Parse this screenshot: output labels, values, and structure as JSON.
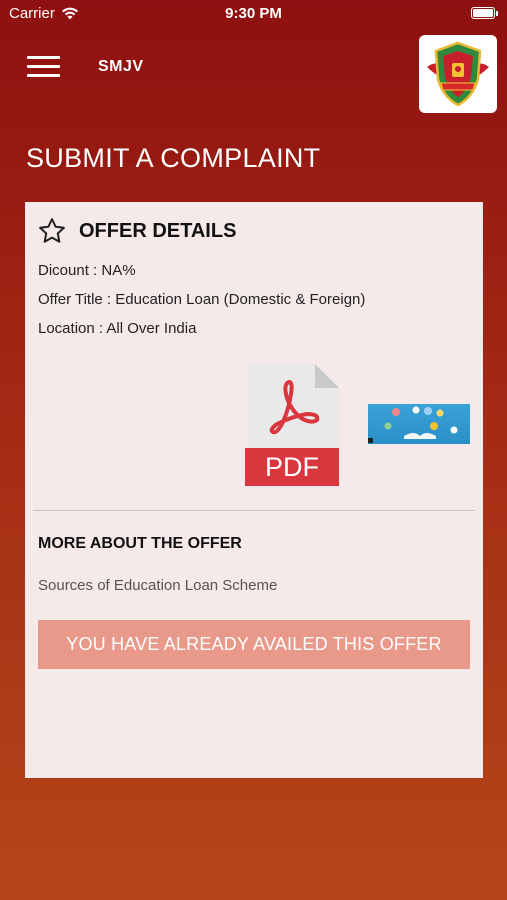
{
  "status_bar": {
    "carrier": "Carrier",
    "time": "9:30 PM",
    "wifi_icon": "wifi-icon",
    "battery_icon": "battery-icon"
  },
  "header": {
    "menu_icon": "hamburger-menu-icon",
    "app_name": "SMJV",
    "logo": "college-crest-logo"
  },
  "page_title": "SUBMIT A COMPLAINT",
  "offer": {
    "icon": "star-icon",
    "heading": "OFFER DETAILS",
    "discount": "Dicount : NA%",
    "offer_title": "Offer Title : Education Loan (Domestic & Foreign)",
    "location": "Location : All Over India",
    "pdf_label": "PDF",
    "more_heading": "MORE ABOUT THE OFFER",
    "more_text": "Sources of Education Loan Scheme",
    "button_label": "YOU HAVE ALREADY AVAILED THIS OFFER"
  },
  "colors": {
    "header_red": "#8e1010",
    "bottom_orange": "#b5461a",
    "card_bg": "#f6e9e9",
    "button_bg": "#e8998a",
    "pdf_red": "#d9363e"
  }
}
